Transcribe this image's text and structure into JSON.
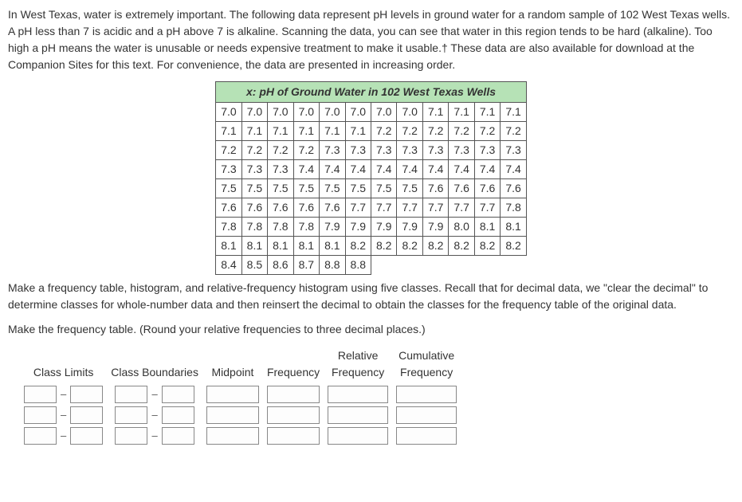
{
  "intro": {
    "paragraph": "In West Texas, water is extremely important. The following data represent pH levels in ground water for a random sample of 102 West Texas wells. A pH less than 7 is acidic and a pH above 7 is alkaline. Scanning the data, you can see that water in this region tends to be hard (alkaline). Too high a pH means the water is unusable or needs expensive treatment to make it usable.† These data are also available for download at the Companion Sites for this text. For convenience, the data are presented in increasing order."
  },
  "data_table": {
    "header_prefix": "x",
    "header_rest": ": pH of Ground Water in 102 West Texas Wells",
    "columns": 12,
    "rows": [
      [
        "7.0",
        "7.0",
        "7.0",
        "7.0",
        "7.0",
        "7.0",
        "7.0",
        "7.0",
        "7.1",
        "7.1",
        "7.1",
        "7.1"
      ],
      [
        "7.1",
        "7.1",
        "7.1",
        "7.1",
        "7.1",
        "7.1",
        "7.2",
        "7.2",
        "7.2",
        "7.2",
        "7.2",
        "7.2"
      ],
      [
        "7.2",
        "7.2",
        "7.2",
        "7.2",
        "7.3",
        "7.3",
        "7.3",
        "7.3",
        "7.3",
        "7.3",
        "7.3",
        "7.3"
      ],
      [
        "7.3",
        "7.3",
        "7.3",
        "7.4",
        "7.4",
        "7.4",
        "7.4",
        "7.4",
        "7.4",
        "7.4",
        "7.4",
        "7.4"
      ],
      [
        "7.5",
        "7.5",
        "7.5",
        "7.5",
        "7.5",
        "7.5",
        "7.5",
        "7.5",
        "7.6",
        "7.6",
        "7.6",
        "7.6"
      ],
      [
        "7.6",
        "7.6",
        "7.6",
        "7.6",
        "7.6",
        "7.7",
        "7.7",
        "7.7",
        "7.7",
        "7.7",
        "7.7",
        "7.8"
      ],
      [
        "7.8",
        "7.8",
        "7.8",
        "7.8",
        "7.9",
        "7.9",
        "7.9",
        "7.9",
        "7.9",
        "8.0",
        "8.1",
        "8.1"
      ],
      [
        "8.1",
        "8.1",
        "8.1",
        "8.1",
        "8.1",
        "8.2",
        "8.2",
        "8.2",
        "8.2",
        "8.2",
        "8.2",
        "8.2"
      ],
      [
        "8.4",
        "8.5",
        "8.6",
        "8.7",
        "8.8",
        "8.8"
      ]
    ]
  },
  "after_table": {
    "paragraph": "Make a frequency table, histogram, and relative-frequency histogram using five classes. Recall that for decimal data, we \"clear the decimal\" to determine classes for whole-number data and then reinsert the decimal to obtain the classes for the frequency table of the original data."
  },
  "prompt": {
    "text": "Make the frequency table. (Round your relative frequencies to three decimal places.)"
  },
  "freq_table": {
    "num_rows": 5,
    "range_sep": "–",
    "columns": [
      {
        "key": "class_limits",
        "label": "Class Limits",
        "type": "range",
        "input_width": "w-sm"
      },
      {
        "key": "class_boundaries",
        "label": "Class Boundaries",
        "type": "range",
        "input_width": "w-sm"
      },
      {
        "key": "midpoint",
        "label": "Midpoint",
        "type": "single",
        "input_width": "w-md"
      },
      {
        "key": "frequency",
        "label": "Frequency",
        "type": "single",
        "input_width": "w-md"
      },
      {
        "key": "rel_freq",
        "label": "Relative\nFrequency",
        "type": "single",
        "input_width": "w-lg"
      },
      {
        "key": "cum_freq",
        "label": "Cumulative\nFrequency",
        "type": "single",
        "input_width": "w-lg"
      }
    ]
  }
}
